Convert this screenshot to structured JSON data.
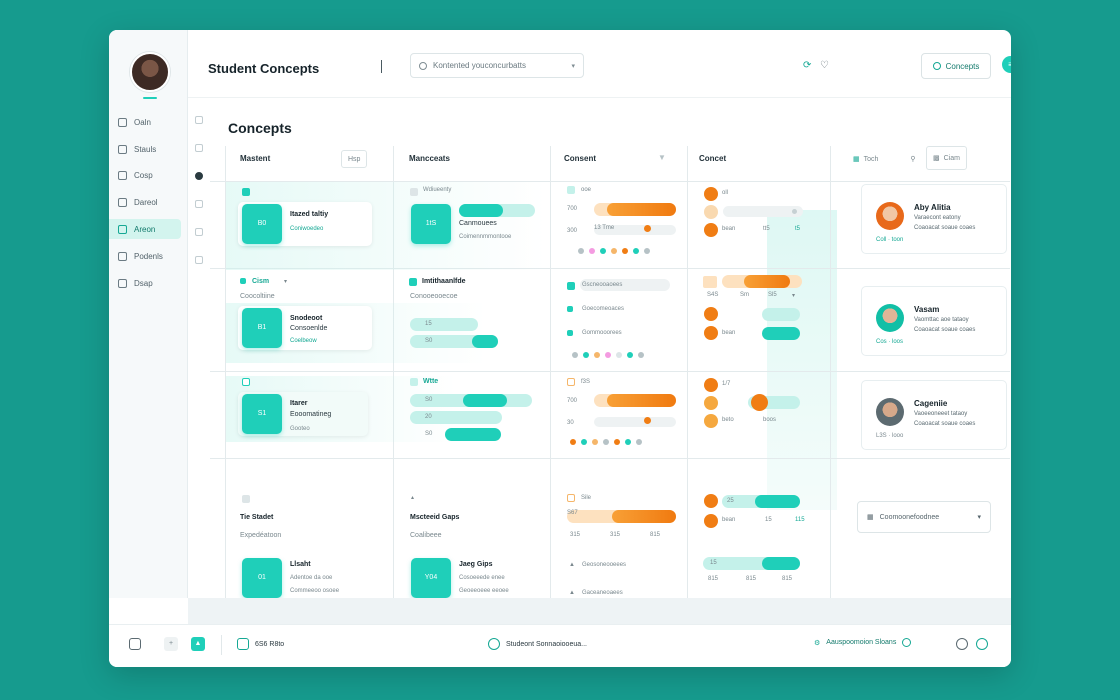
{
  "app": {
    "title": "Student Concepts",
    "search_placeholder": "Kontented youconcurbatts",
    "concepts_button": "Concepts"
  },
  "sidebar": {
    "items": [
      {
        "label": "Oaln"
      },
      {
        "label": "Stauls"
      },
      {
        "label": "Cosp"
      },
      {
        "label": "Dareol"
      },
      {
        "label": "Areon"
      },
      {
        "label": "Podenls"
      },
      {
        "label": "Dsap"
      }
    ],
    "active_index": 4
  },
  "main": {
    "title": "Concepts",
    "columns": [
      {
        "label": "Mastent",
        "button": "Hsp"
      },
      {
        "label": "Mancceats"
      },
      {
        "label": "Consent"
      },
      {
        "label": "Concet"
      }
    ],
    "right_header": {
      "filter": "Toch",
      "button": "Ciam"
    },
    "rows": [
      {
        "c1": {
          "tile": "B0",
          "name": "Itazed taltiy",
          "meta": "Coniwoedeo"
        },
        "c2": {
          "tile": "1tS",
          "line1": "Canmouees",
          "line2": "Coimennmmontooe"
        },
        "c3": {
          "head": "ooe",
          "v1": "700",
          "v2": "300",
          "legend": "13 Tme"
        },
        "c4": {
          "v1": "oll",
          "v2": "bean",
          "v3": "tt5",
          "v4": "t5"
        }
      },
      {
        "c1": {
          "tag": "Cism",
          "sub": "Coocoltiine",
          "tile": "B1",
          "name": "Snodeoot",
          "meta": "Consoenlde",
          "meta2": "Coelbeow"
        },
        "c2": {
          "head": "Imtithaanlfde",
          "sub": "Conooeooecoe",
          "v1": "15",
          "v2": "S0"
        },
        "c3": {
          "l1": "Gscneooaoees",
          "l2": "Goecomeoaces",
          "l3": "Gommooorees"
        },
        "c4": {
          "a": "S4S",
          "b": "Sm",
          "c": "Sl5",
          "d": "bean"
        }
      },
      {
        "c1": {
          "tile": "S1",
          "name": "Itarer",
          "sub": "Eooomatineg",
          "meta": "Gooteo"
        },
        "c2": {
          "head": "Wtte",
          "v1": "S0",
          "v2": "20",
          "v3": "S0"
        },
        "c3": {
          "head": "f3S",
          "v1": "700",
          "v2": "30"
        },
        "c4": {
          "a": "1/7",
          "b": "beto",
          "c": "boos"
        }
      },
      {
        "c1": {
          "head": "Tie Stadet",
          "sub": "Expedéatoon",
          "tile": "01",
          "name": "Llsaht",
          "l1": "Adentoe da ooe",
          "l2": "Commeeoo osoee"
        },
        "c2": {
          "head": "Mscteeid Gaps",
          "sub": "Coalibeee",
          "tile": "Y04",
          "name": "Jaeg Gips",
          "l1": "Cosoeeede enee",
          "l2": "Geoeeoeee eeoee"
        },
        "c3": {
          "head": "Sile",
          "v1": "S67",
          "a": "315",
          "b": "315",
          "c": "815",
          "l1": "Geosoneooeees",
          "l2": "Gaceaneoaees"
        },
        "c4": {
          "v1": "25",
          "v2": "bean",
          "a": "15",
          "b": "115",
          "c": "815",
          "d": "815",
          "e": "815"
        }
      }
    ],
    "people": [
      {
        "name": "Aby Alitia",
        "line1": "Varaecont eatony",
        "line2": "Coaoacat soaue coaes",
        "tag": "Coll · toon"
      },
      {
        "name": "Vasam",
        "line1": "Vaomttac aoe tataoy",
        "line2": "Coaoacat soaue coaes",
        "tag": "Cos · loos"
      },
      {
        "name": "Cageniie",
        "line1": "Vaoeeoneeet tataoy",
        "line2": "Coaoacat soaue coaes",
        "tag": "L3S · looo"
      }
    ],
    "dropdown": "Coomoonefoodnee"
  },
  "footer": {
    "count": "6S6 R8to",
    "center": "Studeont Sonnaoiooeua...",
    "right": "Aauspoomoion Sloans"
  },
  "colors": {
    "accent": "#1fcfb9",
    "orange": "#f07d14",
    "background": "#169b8e"
  }
}
